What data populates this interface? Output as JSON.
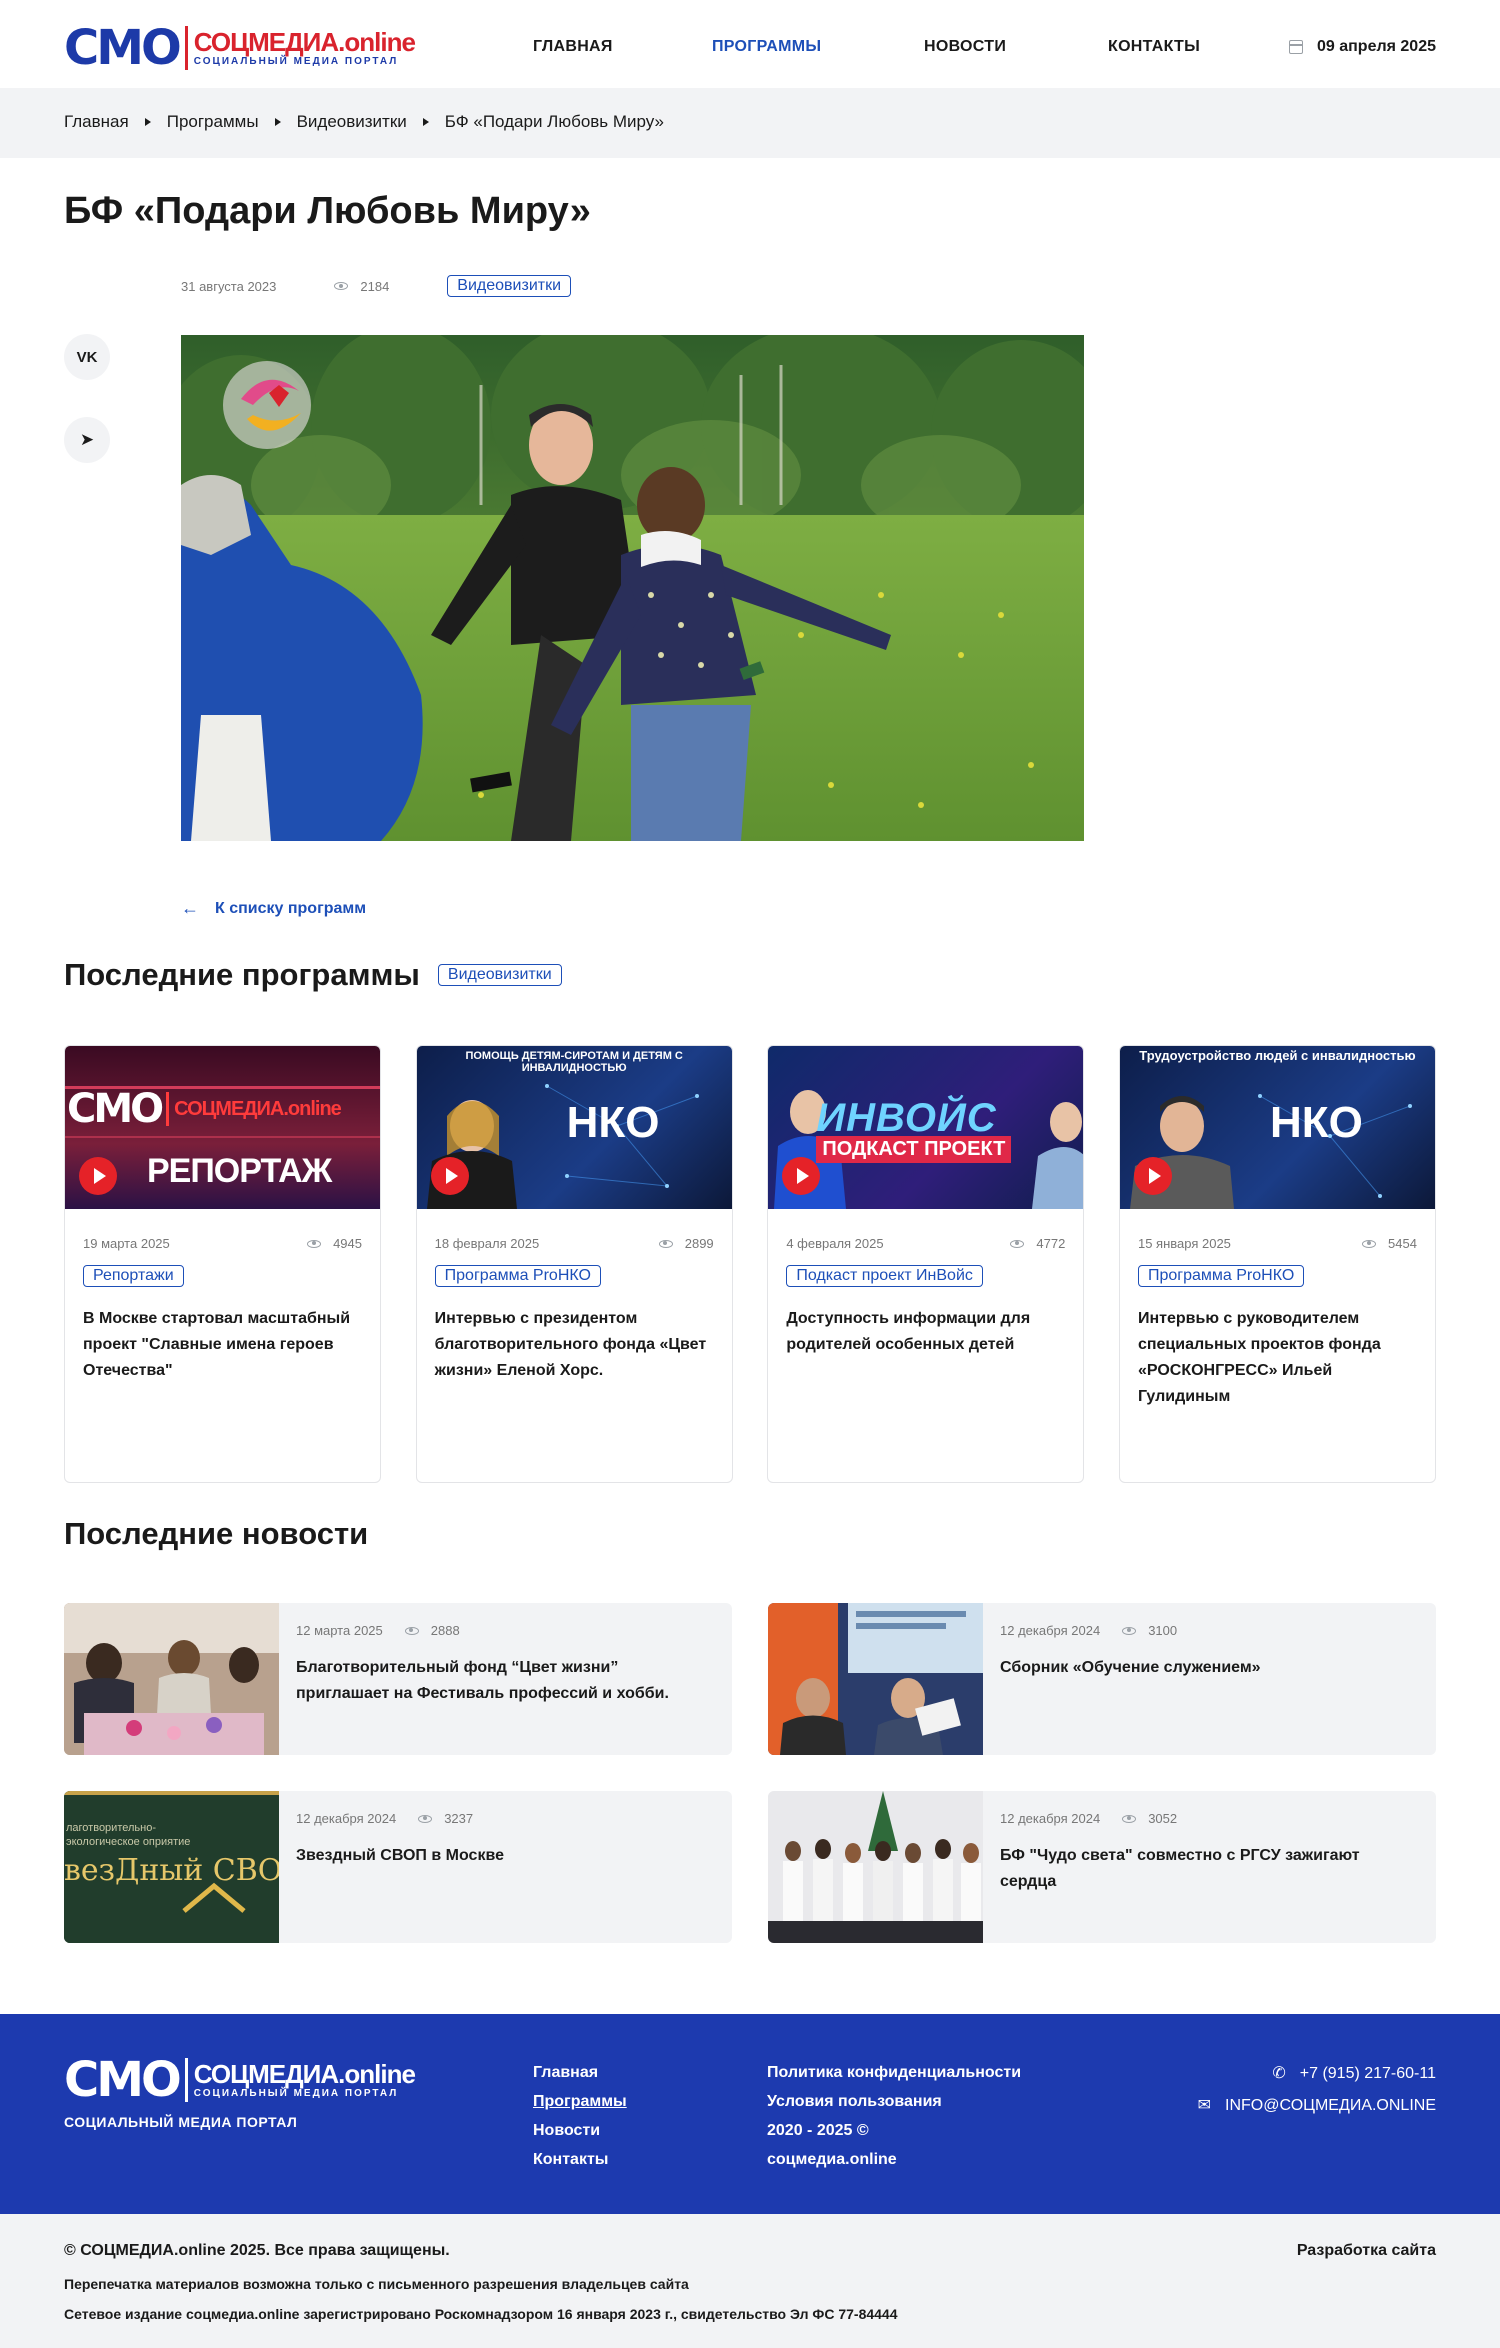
{
  "header": {
    "logo_mark": "СМО",
    "logo_name": "СОЦМЕДИА.online",
    "logo_sub": "СОЦИАЛЬНЫЙ МЕДИА ПОРТАЛ",
    "nav": [
      "ГЛАВНАЯ",
      "ПРОГРАММЫ",
      "НОВОСТИ",
      "КОНТАКТЫ"
    ],
    "active_nav": "ПРОГРАММЫ",
    "date": "09 апреля 2025",
    "accent": "#1d4fb8",
    "brand_red": "#d9232d"
  },
  "breadcrumbs": [
    "Главная",
    "Программы",
    "Видеовизитки",
    "БФ «Подари Любовь Миру»"
  ],
  "article": {
    "title": "БФ «Подари Любовь Миру»",
    "date": "31 августа 2023",
    "views": "2184",
    "tag": "Видеовизитки",
    "share": [
      {
        "icon": "vk-icon",
        "label": "VK"
      },
      {
        "icon": "telegram-icon",
        "label": "➤"
      }
    ],
    "back_label": "К списку программ"
  },
  "latest_programs": {
    "title": "Последние программы",
    "tag": "Видеовизитки",
    "cards": [
      {
        "thumb_text": "РЕПОРТАЖ",
        "thumb_mark": "СМО",
        "thumb_brand": "СОЦМЕДИА.online",
        "date": "19 марта 2025",
        "views": "4945",
        "tag": "Репортажи",
        "title": "В Москве стартовал масштабный проект \"Славные имена героев Отечества\""
      },
      {
        "thumb_text": "НКО",
        "thumb_top": "ПОМОЩЬ ДЕТЯМ-СИРОТАМ И ДЕТЯМ С ИНВАЛИДНОСТЬЮ",
        "date": "18 февраля 2025",
        "views": "2899",
        "tag": "Программа ProНКО",
        "title": "Интервью с президентом благотворительного фонда «Цвет жизни» Еленой Хорс."
      },
      {
        "thumb_text": "ИНВОЙС",
        "thumb_sub": "ПОДКАСТ ПРОЕКТ",
        "date": "4 февраля 2025",
        "views": "4772",
        "tag": "Подкаст проект ИнВойс",
        "title": "Доступность информации для родителей особенных детей"
      },
      {
        "thumb_text": "НКО",
        "thumb_top": "Трудоустройство людей с инвалидностью",
        "date": "15 января 2025",
        "views": "5454",
        "tag": "Программа ProНКО",
        "title": "Интервью с руководителем специальных проектов фонда «РОСКОНГРЕСС» Ильей Гулидиным"
      }
    ]
  },
  "latest_news": {
    "title": "Последние новости",
    "items": [
      {
        "date": "12 марта 2025",
        "views": "2888",
        "title": "Благотворительный фонд “Цвет жизни” приглашает на Фестиваль профессий и хобби."
      },
      {
        "date": "12 декабря 2024",
        "views": "3100",
        "title": "Сборник «Обучение служением»"
      },
      {
        "date": "12 декабря 2024",
        "views": "3237",
        "title": "Звездный СВОП в Москве",
        "thumb_text": "везДный СВОП",
        "thumb_top": "лаготворительно-экологическое оприятие"
      },
      {
        "date": "12 декабря 2024",
        "views": "3052",
        "title": "БФ \"Чудо света\" совместно с РГСУ зажигают сердца"
      }
    ]
  },
  "footer": {
    "tagline": "СОЦИАЛЬНЫЙ МЕДИА ПОРТАЛ",
    "nav": [
      "Главная",
      "Программы",
      "Новости",
      "Контакты"
    ],
    "links": [
      "Политика конфиденциальности",
      "Условия пользования",
      "2020 - 2025 ©",
      "соцмедиа.online"
    ],
    "phone": "+7 (915) 217-60-11",
    "email": "INFO@СОЦМЕДИА.ONLINE",
    "bg": "#1d3aaf"
  },
  "bottom": {
    "copyright": "© СОЦМЕДИА.online 2025. Все права защищены.",
    "reprint": "Перепечатка материалов возможна только с письменного разрешения владельцев сайта",
    "registration": "Сетевое издание соцмедиа.online зарегистрировано Роскомнадзором 16 января 2023 г., свидетельство Эл ФС 77-84444",
    "dev": "Разработка сайта"
  }
}
